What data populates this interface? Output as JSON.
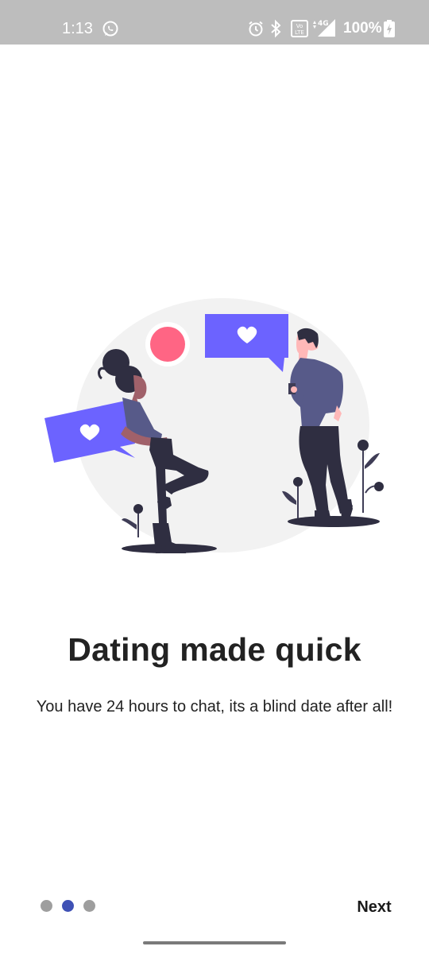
{
  "status_bar": {
    "time": "1:13",
    "battery_percent": "100%",
    "icons": [
      "whatsapp-icon",
      "alarm-icon",
      "bluetooth-icon",
      "volte-icon",
      "signal-4g-icon",
      "battery-charging-icon"
    ],
    "network_label": "4G",
    "volte_label": "Vo LTE"
  },
  "onboarding": {
    "title": "Dating made quick",
    "subtitle": "You have 24 hours to chat, its a blind date after all!",
    "illustration": "couple-chatting-illustration",
    "accent_color": "#6c63ff",
    "pink_color": "#ff6584"
  },
  "pager": {
    "total": 3,
    "active_index": 1
  },
  "navigation": {
    "next_label": "Next"
  }
}
